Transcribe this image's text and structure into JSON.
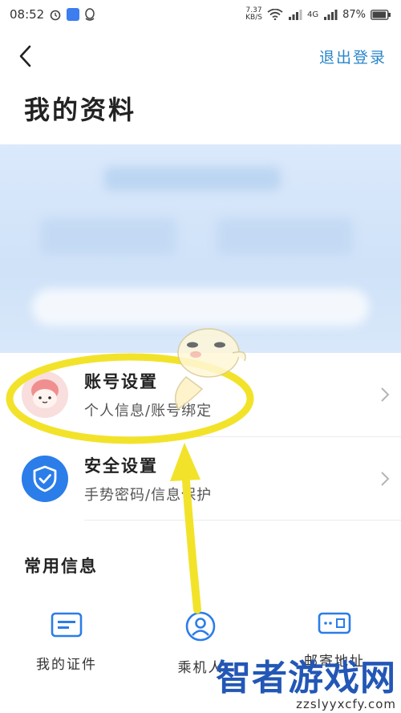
{
  "status_bar": {
    "time": "08:52",
    "net_speed_value": "7.37",
    "net_speed_unit": "KB/S",
    "signal_label": "4G",
    "battery": "87%"
  },
  "header": {
    "back_icon": "chevron-left-icon",
    "logout_label": "退出登录"
  },
  "page": {
    "title": "我的资料"
  },
  "menu": [
    {
      "title": "账号设置",
      "subtitle": "个人信息/账号绑定",
      "icon": "avatar-icon"
    },
    {
      "title": "安全设置",
      "subtitle": "手势密码/信息保护",
      "icon": "shield-check-icon",
      "icon_color": "#2b7de9"
    }
  ],
  "common_info": {
    "title": "常用信息",
    "items": [
      {
        "label": "我的证件",
        "icon": "id-card-icon"
      },
      {
        "label": "乘机人",
        "icon": "person-icon"
      },
      {
        "label": "邮寄地址",
        "icon": "address-card-icon"
      }
    ]
  },
  "watermark": {
    "text": "智者游戏网",
    "url": "zzslyyxcfy.com"
  },
  "colors": {
    "accent": "#2a86c9",
    "annotation": "#f2e32a",
    "profile_bg": "#d6e7fa"
  }
}
